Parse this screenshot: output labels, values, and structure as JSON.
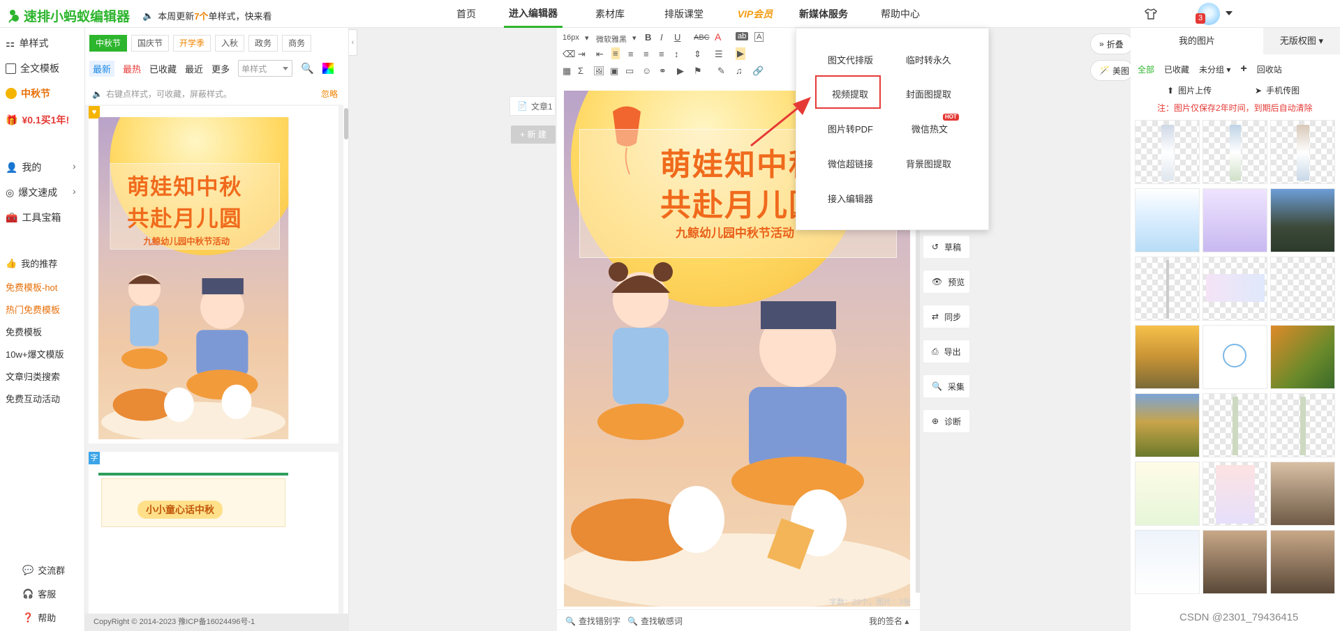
{
  "topbar": {
    "logo": "速排小蚂蚁编辑器",
    "notice_prefix": "本周更新",
    "notice_count": "7个",
    "notice_suffix": "单样式，快来看",
    "nav": [
      "首页",
      "进入编辑器",
      "素材库",
      "排版课堂",
      "VIP会员",
      "新媒体服务",
      "帮助中心"
    ],
    "badge": "3"
  },
  "leftnav": {
    "items": [
      "单样式",
      "全文模板",
      "中秋节",
      "¥0.1买1年!",
      "我的",
      "爆文速成",
      "工具宝箱",
      "我的推荐"
    ],
    "links": [
      "免费模板-hot",
      "热门免费模板",
      "免费模板",
      "10w+爆文模版",
      "文章归类搜索",
      "免费互动活动"
    ],
    "bottom": [
      "交流群",
      "客服",
      "帮助"
    ]
  },
  "templates": {
    "tabs": [
      "中秋节",
      "国庆节",
      "开学季",
      "入秋",
      "政务",
      "商务"
    ],
    "filters": [
      "最新",
      "最热",
      "已收藏",
      "最近",
      "更多"
    ],
    "select": "单样式",
    "tip": "右键点样式，可收藏，屏蔽样式。",
    "ignore": "忽略",
    "card1_title1": "萌娃知中秋",
    "card1_title2": "共赴月儿圆",
    "card1_subtitle": "九鲸幼儿园中秋节活动",
    "card2_banner": "小小童心话中秋",
    "card1_icon": "♥",
    "card2_icon": "字"
  },
  "copyright": "CopyRight © 2014-2023 豫ICP备16024496号-1",
  "editor": {
    "doc_label": "文章1",
    "new_label": "新 建",
    "font_size": "16px",
    "font_family": "微软雅黑",
    "title1": "萌娃知中秋",
    "title2": "共赴月儿圆",
    "subtitle": "九鲸幼儿园中秋节活动",
    "word_count": "字数：29个，图片：3张",
    "find_typo": "查找错别字",
    "find_sensitive": "查找敏感词",
    "signature": "我的签名"
  },
  "side_actions": [
    "草稿",
    "预览",
    "同步",
    "导出",
    "采集",
    "诊断"
  ],
  "dropdown": {
    "items": [
      "图文代排版",
      "临时转永久",
      "视频提取",
      "封面图提取",
      "图片转PDF",
      "微信热文",
      "微信超链接",
      "背景图提取",
      "接入编辑器"
    ],
    "hot_badge": "HOT"
  },
  "right": {
    "collapse": "折叠",
    "beauty": "美图",
    "tab_mine": "我的图片",
    "tab_free": "无版权图",
    "filters": [
      "全部",
      "已收藏",
      "未分组",
      "回收站"
    ],
    "upload": "图片上传",
    "mobile": "手机传图",
    "note": "注：图片仅保存2年时间，到期后自动清除"
  },
  "watermark": "CSDN @2301_79436415",
  "colors": {
    "brand_green": "#2db52d",
    "accent_orange": "#f08300",
    "alert_red": "#e53935"
  }
}
